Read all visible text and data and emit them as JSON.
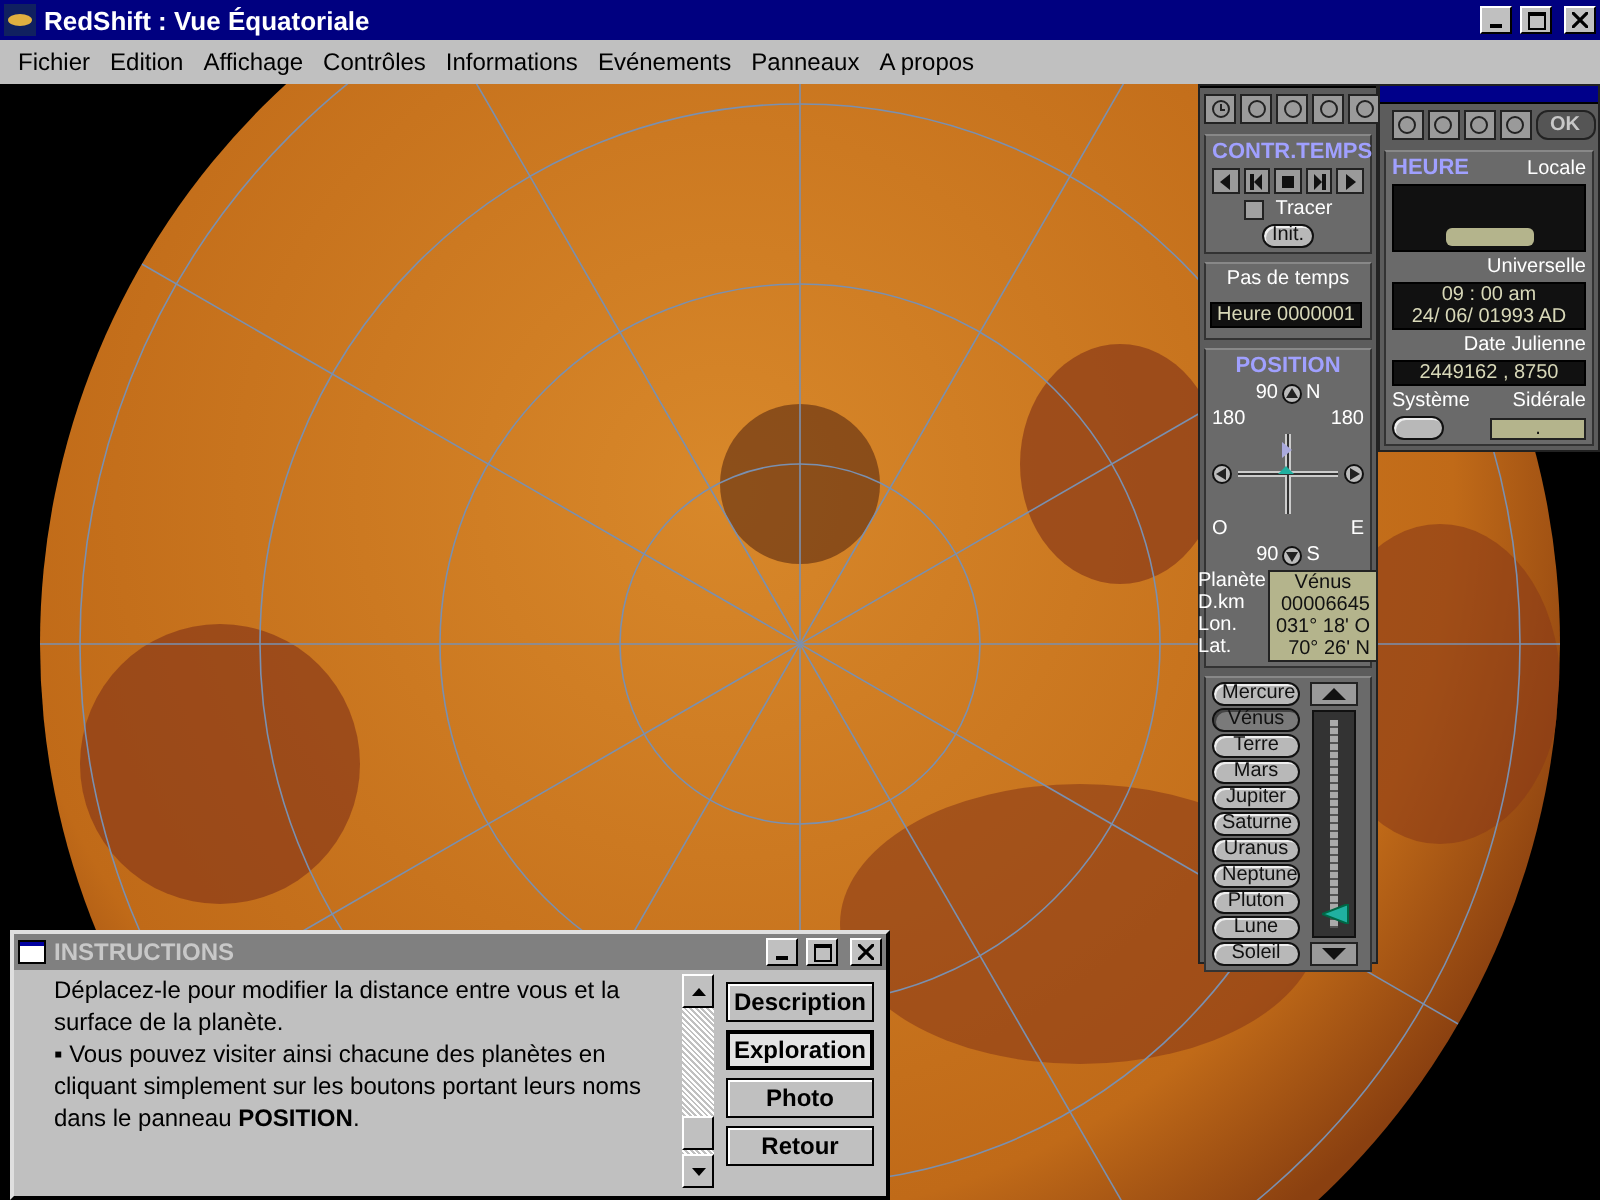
{
  "window": {
    "title": "RedShift : Vue Équatoriale"
  },
  "menu": [
    "Fichier",
    "Edition",
    "Affichage",
    "Contrôles",
    "Informations",
    "Evénements",
    "Panneaux",
    "A propos"
  ],
  "time_panel": {
    "title": "CONTR.TEMPS",
    "tracer": {
      "label": "Tracer",
      "checked": false
    },
    "init_button": "Init.",
    "step_label": "Pas de temps",
    "step_value": "Heure 0000001"
  },
  "position_panel": {
    "title": "POSITION",
    "north": {
      "value": "90",
      "label": "N"
    },
    "west": {
      "value": "180",
      "label": "O"
    },
    "east": {
      "value": "180",
      "label": "E"
    },
    "south": {
      "value": "90",
      "label": "S"
    },
    "info": [
      {
        "label": "Planète",
        "value": "Vénus"
      },
      {
        "label": "D.km",
        "value": "00006645"
      },
      {
        "label": "Lon.",
        "value": "031° 18' O"
      },
      {
        "label": "Lat.",
        "value": "70° 26' N"
      }
    ]
  },
  "planets": [
    {
      "label": "Mercure",
      "selected": false
    },
    {
      "label": "Vénus",
      "selected": true
    },
    {
      "label": "Terre",
      "selected": false
    },
    {
      "label": "Mars",
      "selected": false
    },
    {
      "label": "Jupiter",
      "selected": false
    },
    {
      "label": "Saturne",
      "selected": false
    },
    {
      "label": "Uranus",
      "selected": false
    },
    {
      "label": "Neptune",
      "selected": false
    },
    {
      "label": "Pluton",
      "selected": false
    },
    {
      "label": "Lune",
      "selected": false
    },
    {
      "label": "Soleil",
      "selected": false
    }
  ],
  "distance": {
    "level": 0.04
  },
  "clock_panel": {
    "ok_button": {
      "label": "OK",
      "disabled": true
    },
    "title": "HEURE",
    "local_label": "Locale",
    "universal_label": "Universelle",
    "time": "09 : 00 am",
    "date": "24/ 06/ 01993 AD",
    "julian_label": "Date Julienne",
    "julian": "2449162 , 8750",
    "system_button": "Système",
    "sidereal_label": "Sidérale",
    "sidereal_value": "."
  },
  "instructions": {
    "title": "INSTRUCTIONS",
    "paragraphs": [
      "Déplacez-le pour modifier la distance entre vous et la surface de la planète.",
      "▪  Vous pouvez visiter ainsi chacune des planètes en cliquant simplement sur les boutons portant leurs noms dans le panneau **POSITION**."
    ],
    "buttons": [
      {
        "label": "Description",
        "selected": false
      },
      {
        "label": "Exploration",
        "selected": true
      },
      {
        "label": "Photo",
        "selected": false
      },
      {
        "label": "Retour",
        "selected": false
      }
    ]
  }
}
